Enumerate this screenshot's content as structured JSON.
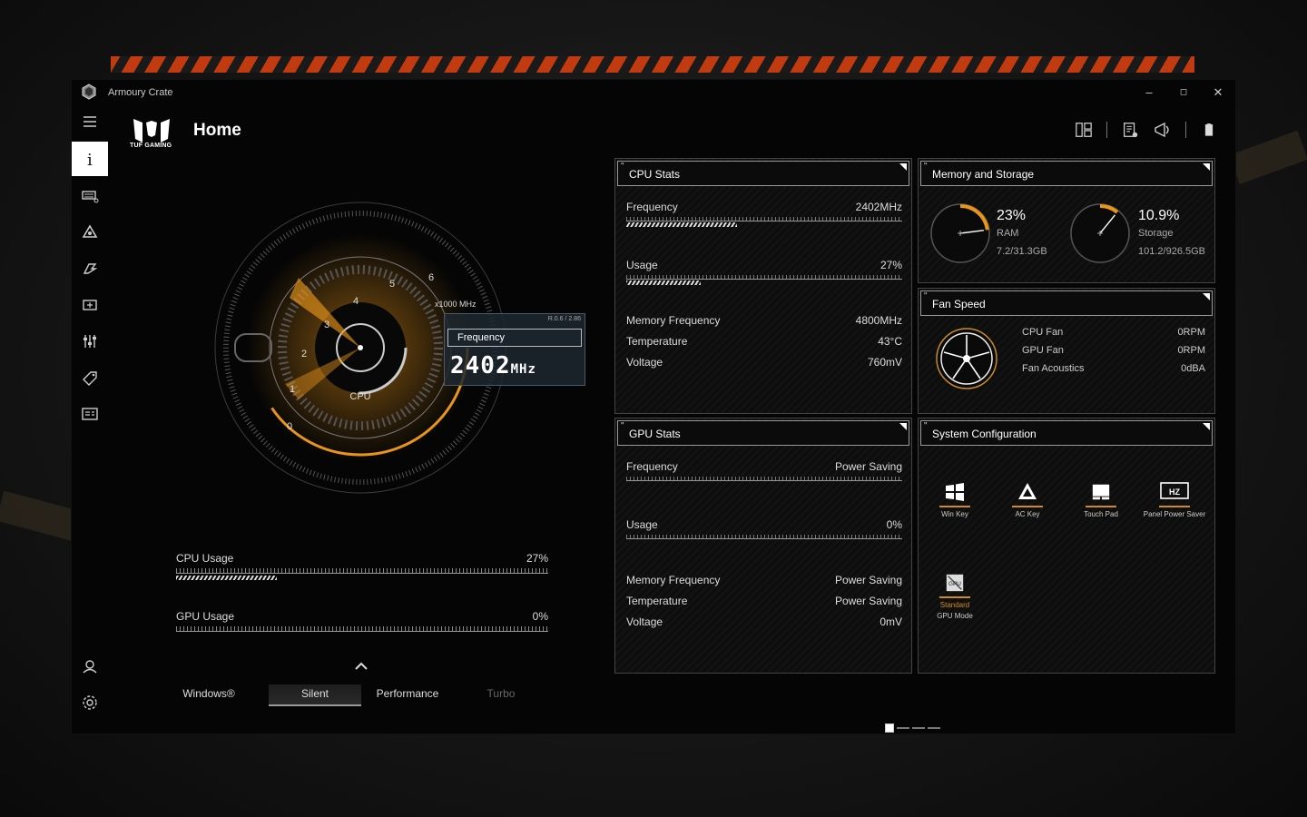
{
  "window": {
    "title": "Armoury Crate",
    "minimize": "–",
    "maximize": "◻",
    "close": "✕"
  },
  "brand": {
    "name": "TUF GAMING"
  },
  "page": {
    "title": "Home"
  },
  "sidebar": {
    "items": [
      {
        "icon": "menu-icon"
      },
      {
        "icon": "info-icon",
        "active": true
      },
      {
        "icon": "keyboard-icon"
      },
      {
        "icon": "aura-icon"
      },
      {
        "icon": "gamevisual-icon"
      },
      {
        "icon": "scenario-icon"
      },
      {
        "icon": "sliders-icon"
      },
      {
        "icon": "tag-icon"
      },
      {
        "icon": "news-icon"
      },
      {
        "icon": "user-icon"
      },
      {
        "icon": "settings-icon"
      }
    ]
  },
  "gauge": {
    "label": "CPU",
    "scale_unit": "x1000 MHz",
    "scale_ticks": [
      "0",
      "1",
      "2",
      "3",
      "4",
      "5",
      "6"
    ],
    "box_rev": "R.0.6 / 2.86",
    "box_label": "Frequency",
    "box_value": "2402",
    "box_unit": "MHz",
    "frequency_ghz": 2.402,
    "accent": "#e8951a"
  },
  "usage": {
    "cpu": {
      "label": "CPU Usage",
      "value": "27%",
      "fraction": 0.27
    },
    "gpu": {
      "label": "GPU Usage",
      "value": "0%",
      "fraction": 0.0
    }
  },
  "modes": {
    "items": [
      "Windows®",
      "Silent",
      "Performance",
      "Turbo"
    ],
    "selected": "Silent"
  },
  "cpu_stats": {
    "title": "CPU Stats",
    "frequency": {
      "label": "Frequency",
      "value": "2402MHz",
      "fraction": 0.4
    },
    "usage": {
      "label": "Usage",
      "value": "27%",
      "fraction": 0.27
    },
    "memory_frequency": {
      "label": "Memory Frequency",
      "value": "4800MHz"
    },
    "temperature": {
      "label": "Temperature",
      "value": "43°C"
    },
    "voltage": {
      "label": "Voltage",
      "value": "760mV"
    }
  },
  "gpu_stats": {
    "title": "GPU Stats",
    "frequency": {
      "label": "Frequency",
      "value": "Power Saving"
    },
    "usage": {
      "label": "Usage",
      "value": "0%"
    },
    "memory_frequency": {
      "label": "Memory Frequency",
      "value": "Power Saving"
    },
    "temperature": {
      "label": "Temperature",
      "value": "Power Saving"
    },
    "voltage": {
      "label": "Voltage",
      "value": "0mV"
    }
  },
  "memory_storage": {
    "title": "Memory and Storage",
    "ram": {
      "percent": "23%",
      "label": "RAM",
      "detail": "7.2/31.3GB",
      "fraction": 0.23
    },
    "storage": {
      "percent": "10.9%",
      "label": "Storage",
      "detail": "101.2/926.5GB",
      "fraction": 0.109
    }
  },
  "fan_speed": {
    "title": "Fan Speed",
    "cpu_fan": {
      "label": "CPU Fan",
      "value": "0RPM"
    },
    "gpu_fan": {
      "label": "GPU Fan",
      "value": "0RPM"
    },
    "acoustics": {
      "label": "Fan Acoustics",
      "value": "0dBA"
    }
  },
  "system_config": {
    "title": "System Configuration",
    "items": [
      {
        "label": "Win Key",
        "icon": "windows-icon"
      },
      {
        "label": "AC Key",
        "icon": "ac-key-icon"
      },
      {
        "label": "Touch Pad",
        "icon": "touchpad-icon"
      },
      {
        "label": "Panel Power Saver",
        "icon": "hz-icon"
      }
    ],
    "gpu_mode": {
      "label": "GPU Mode",
      "value": "Standard",
      "icon": "gpu-icon"
    }
  },
  "colors": {
    "accent": "#e8951a",
    "hazard": "#c23a10"
  }
}
